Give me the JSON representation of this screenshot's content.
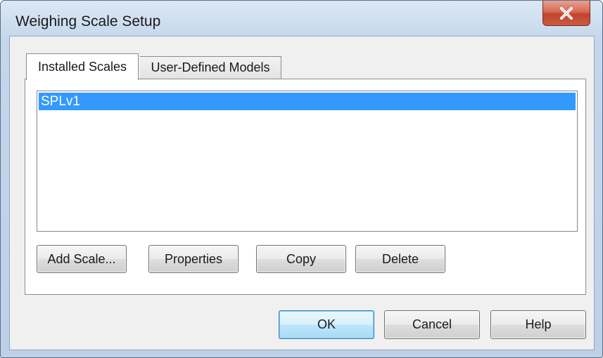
{
  "window": {
    "title": "Weighing Scale Setup"
  },
  "titlebar": {
    "close_icon": "close-icon"
  },
  "tabs": [
    {
      "label": "Installed Scales",
      "selected": true
    },
    {
      "label": "User-Defined Models",
      "selected": false
    }
  ],
  "scales_list": {
    "items": [
      {
        "label": "SPLv1",
        "selected": true
      }
    ]
  },
  "panel_buttons": {
    "add_scale": "Add Scale...",
    "properties": "Properties",
    "copy": "Copy",
    "delete": "Delete"
  },
  "dialog_buttons": {
    "ok": "OK",
    "cancel": "Cancel",
    "help": "Help"
  },
  "colors": {
    "selection": "#3399ff",
    "close_button": "#c2432b"
  }
}
